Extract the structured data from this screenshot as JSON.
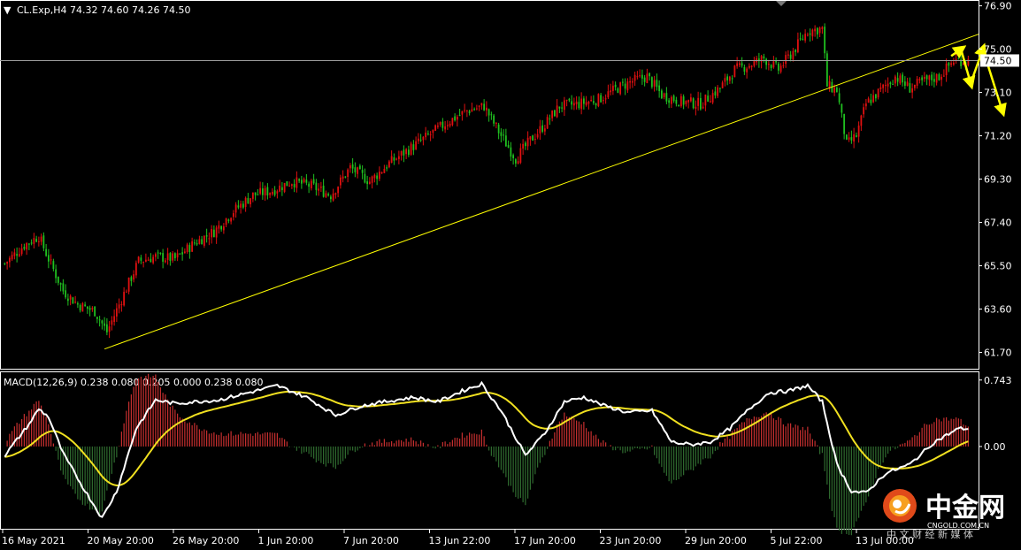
{
  "header": {
    "arrow": "▼",
    "text": "CL.Exp,H4  74.32 74.60 74.26 74.50"
  },
  "macd": {
    "label": "MACD(12,26,9) 0.238 0.080 0.205 0.000 0.238 0.080"
  },
  "current_price_label": "74.50",
  "watermark": {
    "brand": "中金网",
    "site": "CNGOLD.COM.CN",
    "slogan": "中 文 财 经 新 媒 体"
  },
  "colors": {
    "background": "#000000",
    "bull": "#e01010",
    "bear": "#20c020",
    "trendline": "#ffff00",
    "macd_main": "#ffffff",
    "macd_signal": "#f0e020",
    "hist_pos": "#c83030",
    "hist_neg": "#2f6b2f",
    "axis": "#ffffff",
    "arrows": "#ffff00"
  },
  "chart_data": {
    "type": "candlestick",
    "symbol": "CL.Exp",
    "timeframe": "H4",
    "y_ticks_price": [
      "76.90",
      "75.00",
      "73.10",
      "71.20",
      "69.30",
      "67.40",
      "65.50",
      "63.60",
      "61.70"
    ],
    "y_ticks_macd": [
      "0.743",
      "0.00"
    ],
    "x_ticks": [
      "16 May 2021",
      "20 May 20:00",
      "26 May 20:00",
      "1 Jun 20:00",
      "7 Jun 20:00",
      "13 Jun 22:00",
      "17 Jun 20:00",
      "23 Jun 20:00",
      "29 Jun 20:00",
      "5 Jul 22:00",
      "13 Jul 00:00"
    ],
    "price_ylim": [
      61.1,
      77.0
    ],
    "macd_ylim": [
      -0.9,
      0.8
    ],
    "close_anchors": [
      [
        0,
        65.6
      ],
      [
        8,
        66.4
      ],
      [
        14,
        66.8
      ],
      [
        18,
        65.8
      ],
      [
        24,
        64.4
      ],
      [
        30,
        63.8
      ],
      [
        37,
        63.5
      ],
      [
        42,
        62.6
      ],
      [
        47,
        63.8
      ],
      [
        55,
        65.7
      ],
      [
        62,
        65.9
      ],
      [
        70,
        65.8
      ],
      [
        78,
        66.5
      ],
      [
        86,
        67.0
      ],
      [
        94,
        67.9
      ],
      [
        102,
        68.6
      ],
      [
        110,
        68.8
      ],
      [
        118,
        69.2
      ],
      [
        126,
        69.0
      ],
      [
        134,
        68.6
      ],
      [
        142,
        69.8
      ],
      [
        150,
        69.2
      ],
      [
        158,
        70.0
      ],
      [
        166,
        70.6
      ],
      [
        174,
        71.2
      ],
      [
        182,
        71.8
      ],
      [
        190,
        72.3
      ],
      [
        197,
        72.5
      ],
      [
        204,
        71.2
      ],
      [
        210,
        70.2
      ],
      [
        216,
        71.0
      ],
      [
        222,
        71.7
      ],
      [
        228,
        72.5
      ],
      [
        236,
        72.6
      ],
      [
        244,
        72.8
      ],
      [
        252,
        73.3
      ],
      [
        258,
        73.6
      ],
      [
        264,
        73.8
      ],
      [
        270,
        73.0
      ],
      [
        278,
        72.7
      ],
      [
        286,
        72.6
      ],
      [
        294,
        73.3
      ],
      [
        300,
        74.1
      ],
      [
        306,
        74.3
      ],
      [
        312,
        74.6
      ],
      [
        318,
        74.1
      ],
      [
        324,
        74.9
      ],
      [
        330,
        75.8
      ],
      [
        336,
        75.9
      ],
      [
        338,
        73.4
      ],
      [
        342,
        73.2
      ],
      [
        346,
        70.8
      ],
      [
        350,
        71.2
      ],
      [
        354,
        72.6
      ],
      [
        360,
        73.2
      ],
      [
        366,
        73.8
      ],
      [
        372,
        73.3
      ],
      [
        378,
        73.6
      ],
      [
        384,
        73.8
      ],
      [
        390,
        74.5
      ],
      [
        396,
        74.5
      ]
    ],
    "macd_anchors": [
      [
        0,
        -0.1
      ],
      [
        10,
        0.25
      ],
      [
        14,
        0.42
      ],
      [
        18,
        0.33
      ],
      [
        24,
        -0.08
      ],
      [
        32,
        -0.45
      ],
      [
        40,
        -0.8
      ],
      [
        46,
        -0.5
      ],
      [
        54,
        0.2
      ],
      [
        62,
        0.52
      ],
      [
        70,
        0.48
      ],
      [
        78,
        0.5
      ],
      [
        88,
        0.52
      ],
      [
        100,
        0.6
      ],
      [
        112,
        0.68
      ],
      [
        124,
        0.55
      ],
      [
        136,
        0.35
      ],
      [
        146,
        0.45
      ],
      [
        156,
        0.5
      ],
      [
        168,
        0.55
      ],
      [
        178,
        0.5
      ],
      [
        188,
        0.62
      ],
      [
        196,
        0.7
      ],
      [
        204,
        0.4
      ],
      [
        214,
        -0.1
      ],
      [
        222,
        0.15
      ],
      [
        230,
        0.5
      ],
      [
        238,
        0.55
      ],
      [
        246,
        0.46
      ],
      [
        256,
        0.38
      ],
      [
        266,
        0.4
      ],
      [
        274,
        0.05
      ],
      [
        282,
        0.02
      ],
      [
        290,
        0.05
      ],
      [
        298,
        0.2
      ],
      [
        306,
        0.42
      ],
      [
        314,
        0.6
      ],
      [
        322,
        0.62
      ],
      [
        330,
        0.68
      ],
      [
        336,
        0.5
      ],
      [
        342,
        -0.2
      ],
      [
        348,
        -0.5
      ],
      [
        354,
        -0.52
      ],
      [
        362,
        -0.3
      ],
      [
        372,
        -0.2
      ],
      [
        382,
        0.05
      ],
      [
        392,
        0.2
      ],
      [
        396,
        0.2
      ]
    ],
    "macd_signal_period": 9,
    "trendline": {
      "from": [
        41,
        61.85
      ],
      "to": [
        430,
        76.8
      ]
    },
    "current_price": 74.5,
    "projection": [
      {
        "from": [
          389,
          74.7
        ],
        "to": [
          393,
          75.0
        ]
      },
      {
        "from": [
          393,
          75.0
        ],
        "to": [
          397,
          73.5
        ]
      },
      {
        "from": [
          397,
          73.5
        ],
        "to": [
          402,
          75.0
        ]
      },
      {
        "from": [
          402,
          75.0
        ],
        "to": [
          410,
          72.3
        ]
      }
    ]
  }
}
